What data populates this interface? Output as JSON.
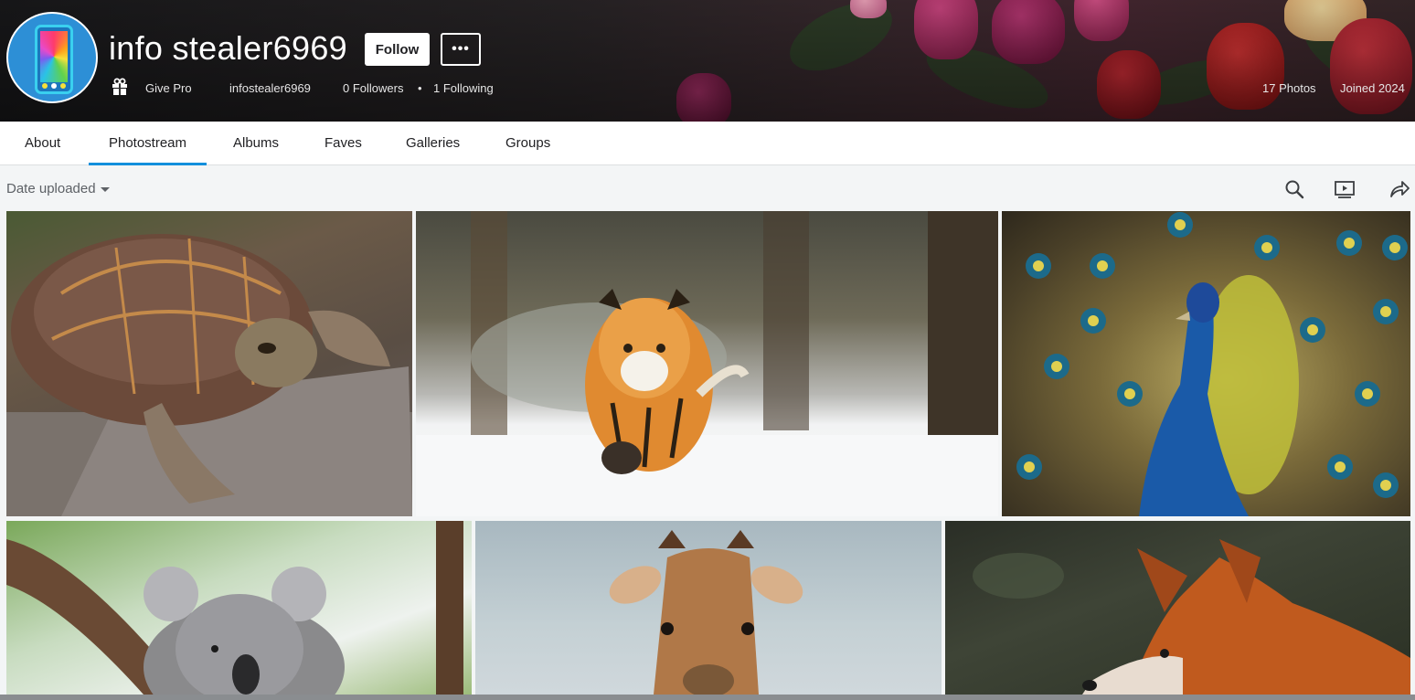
{
  "profile": {
    "display_name": "info stealer6969",
    "handle": "infostealer6969",
    "give_pro": "Give Pro",
    "followers": "0 Followers",
    "separator": "•",
    "following": "1 Following",
    "photo_count": "17 Photos",
    "joined": "Joined 2024",
    "follow_label": "Follow",
    "more_label": "•••"
  },
  "tabs": [
    {
      "label": "About",
      "active": false
    },
    {
      "label": "Photostream",
      "active": true
    },
    {
      "label": "Albums",
      "active": false
    },
    {
      "label": "Faves",
      "active": false
    },
    {
      "label": "Galleries",
      "active": false
    },
    {
      "label": "Groups",
      "active": false
    }
  ],
  "toolbar": {
    "sort_label": "Date uploaded"
  },
  "colors": {
    "accent": "#128fdc",
    "background": "#f3f5f6",
    "nav_background": "#ffffff"
  },
  "icons": [
    "gift-icon",
    "search-icon",
    "slideshow-icon",
    "share-icon",
    "chevron-down-icon"
  ],
  "photos": [
    {
      "subject": "turtle"
    },
    {
      "subject": "tiger"
    },
    {
      "subject": "peacock"
    },
    {
      "subject": "koala"
    },
    {
      "subject": "giraffe"
    },
    {
      "subject": "fox"
    }
  ]
}
